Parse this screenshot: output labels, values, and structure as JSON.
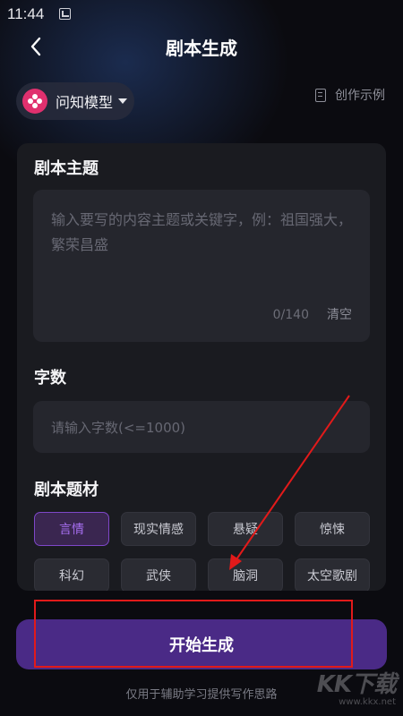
{
  "status_bar": {
    "time": "11:44"
  },
  "header": {
    "title": "剧本生成"
  },
  "model_selector": {
    "label": "问知模型"
  },
  "examples_link": {
    "label": "创作示例"
  },
  "topic": {
    "label": "剧本主题",
    "placeholder": "输入要写的内容主题或关键字，例：祖国强大，繁荣昌盛",
    "count": "0/140",
    "clear": "清空"
  },
  "word_count": {
    "label": "字数",
    "placeholder": "请输入字数(<=1000)"
  },
  "genre": {
    "label": "剧本题材",
    "selected": "言情",
    "options": [
      "言情",
      "现实情感",
      "悬疑",
      "惊悚",
      "科幻",
      "武侠",
      "脑洞",
      "太空歌剧"
    ]
  },
  "start_button": {
    "label": "开始生成"
  },
  "disclaimer": "仅用于辅助学习提供写作思路",
  "watermark": {
    "logo": "KK下载",
    "url": "www.kkx.net"
  },
  "colors": {
    "accent": "#4a2a86",
    "selected_chip_text": "#a76ff0",
    "annotation": "#e21a1a",
    "model_logo": "#e0306e"
  }
}
